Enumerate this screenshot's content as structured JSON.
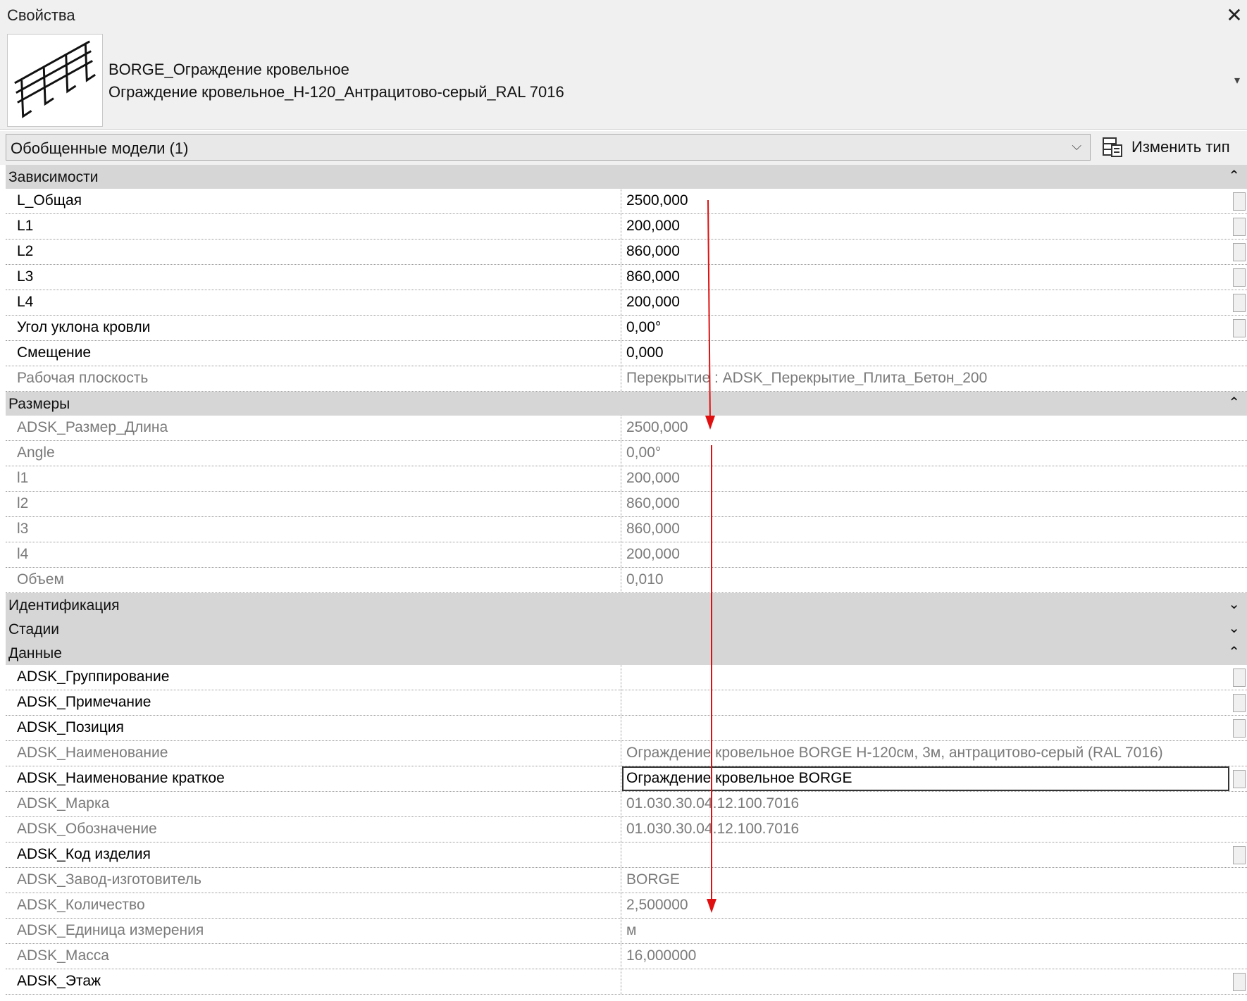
{
  "window": {
    "title": "Свойства",
    "close_symbol": "✕"
  },
  "type_selector": {
    "family": "BORGE_Ограждение кровельное",
    "type": "Ограждение кровельное_Н-120_Антрацитово-серый_RAL 7016",
    "caret": "▾"
  },
  "filter": {
    "selected": "Обобщенные модели (1)",
    "chevron": "⌵",
    "edit_type_label": "Изменить тип"
  },
  "groups": [
    {
      "name": "Зависимости",
      "toggle": "⌃",
      "rows": [
        {
          "name": "L_Общая",
          "value": "2500,000"
        },
        {
          "name": "L1",
          "value": "200,000"
        },
        {
          "name": "L2",
          "value": "860,000"
        },
        {
          "name": "L3",
          "value": "860,000"
        },
        {
          "name": "L4",
          "value": "200,000"
        },
        {
          "name": "Угол уклона кровли",
          "value": "0,00°"
        },
        {
          "name": "Смещение",
          "value": "0,000"
        },
        {
          "name": "Рабочая плоскость",
          "value": "Перекрытие : ADSK_Перекрытие_Плита_Бетон_200"
        }
      ]
    },
    {
      "name": "Размеры",
      "toggle": "⌃",
      "rows": [
        {
          "name": "ADSK_Размер_Длина",
          "value": "2500,000"
        },
        {
          "name": "Angle",
          "value": "0,00°"
        },
        {
          "name": "l1",
          "value": "200,000"
        },
        {
          "name": "l2",
          "value": "860,000"
        },
        {
          "name": "l3",
          "value": "860,000"
        },
        {
          "name": "l4",
          "value": "200,000"
        },
        {
          "name": "Объем",
          "value": "0,010"
        }
      ]
    },
    {
      "name": "Идентификация",
      "toggle": "⌄",
      "rows": []
    },
    {
      "name": "Стадии",
      "toggle": "⌄",
      "rows": []
    },
    {
      "name": "Данные",
      "toggle": "⌃",
      "rows": [
        {
          "name": "ADSK_Группирование",
          "value": ""
        },
        {
          "name": "ADSK_Примечание",
          "value": ""
        },
        {
          "name": "ADSK_Позиция",
          "value": ""
        },
        {
          "name": "ADSK_Наименование",
          "value": "Ограждение кровельное BORGE H-120см, 3м, антрацитово-серый (RAL 7016)"
        },
        {
          "name": "ADSK_Наименование краткое",
          "value": "Ограждение кровельное BORGE"
        },
        {
          "name": "ADSK_Марка",
          "value": "01.030.30.04.12.100.7016"
        },
        {
          "name": "ADSK_Обозначение",
          "value": "01.030.30.04.12.100.7016"
        },
        {
          "name": "ADSK_Код изделия",
          "value": ""
        },
        {
          "name": "ADSK_Завод-изготовитель",
          "value": "BORGE"
        },
        {
          "name": "ADSK_Количество",
          "value": "2,500000"
        },
        {
          "name": "ADSK_Единица измерения",
          "value": "м"
        },
        {
          "name": "ADSK_Масса",
          "value": "16,000000"
        },
        {
          "name": "ADSK_Этаж",
          "value": ""
        }
      ]
    }
  ],
  "colors": {
    "annotation_arrow": "#e01010",
    "group_bg": "#d6d6d6",
    "readonly_text": "#7a7a7a"
  }
}
